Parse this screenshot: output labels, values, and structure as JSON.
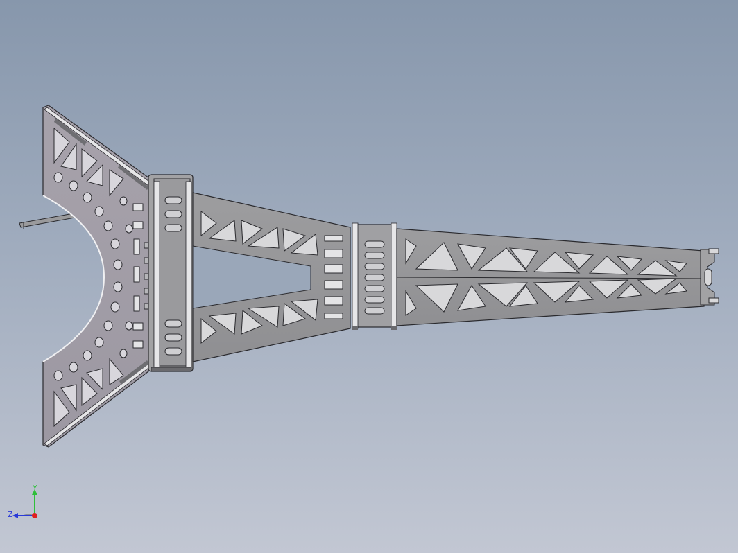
{
  "viewport": {
    "background_top": "#8797ac",
    "background_bottom": "#c2c7d3",
    "model_fill": "#a4a0a8",
    "model_edge": "#2a2a2e",
    "highlight_fill": "#e8e8ea"
  },
  "triad": {
    "y_label": "Y",
    "z_label": "Z",
    "y_color": "#2fbf3a",
    "z_color": "#2a3ad8",
    "origin_color": "#e02020"
  }
}
